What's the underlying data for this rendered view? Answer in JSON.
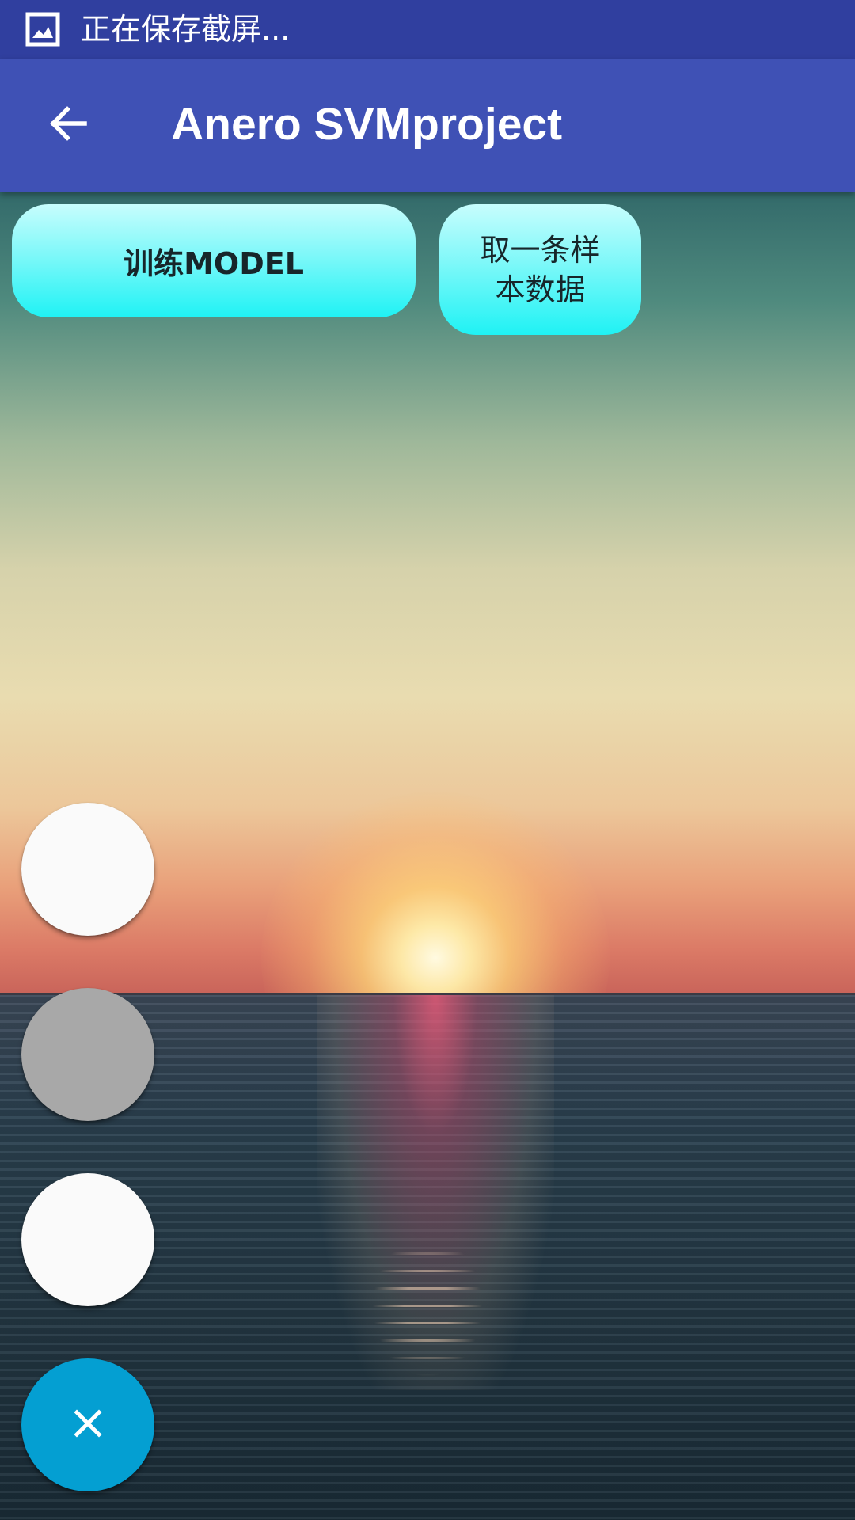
{
  "status_bar": {
    "icon": "screenshot-image-icon",
    "text": "正在保存截屏..."
  },
  "app_bar": {
    "back_icon": "arrow-left-icon",
    "title": "Anero SVMproject"
  },
  "buttons": {
    "train_label": "训练MODEL",
    "sample_label": "取一条样本数据"
  },
  "fab_menu": {
    "close_icon": "close-icon",
    "items": [
      {
        "color": "#fafafa"
      },
      {
        "color": "#a8a8a8"
      },
      {
        "color": "#fafafa"
      }
    ]
  },
  "colors": {
    "status_bar": "#303f9f",
    "app_bar": "#3f51b5",
    "button_cyan": "#1ff2f4",
    "fab_close": "#049fd2"
  }
}
